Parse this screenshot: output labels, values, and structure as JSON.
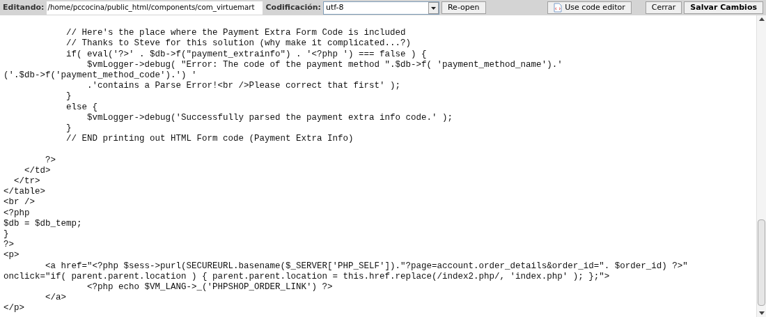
{
  "toolbar": {
    "file_label": "Editando:",
    "file_path": "/home/pccocina/public_html/components/com_virtuemart",
    "encoding_label": "Codificación:",
    "encoding_value": "utf-8",
    "buttons": [
      {
        "label": "Re-open",
        "kind": "plain",
        "bold": false
      },
      {
        "label": "Use code editor",
        "kind": "icon",
        "bold": false
      },
      {
        "label": "Cerrar",
        "kind": "plain",
        "bold": false
      },
      {
        "label": "Salvar Cambios",
        "kind": "plain",
        "bold": true
      }
    ]
  },
  "code_lines": [
    {
      "text": "            // Here's the place where the Payment Extra Form Code is included",
      "gap_before": true
    },
    {
      "text": "            // Thanks to Steve for this solution (why make it complicated...?)",
      "gap_before": false
    },
    {
      "text": "            if( eval('?>' . $db->f(\"payment_extrainfo\") . '<?php ') === false ) {",
      "gap_before": false
    },
    {
      "text": "                $vmLogger->debug( \"Error: The code of the payment method \".$db->f( 'payment_method_name').'",
      "gap_before": false
    },
    {
      "text": "('.$db->f('payment_method_code').') '",
      "gap_before": false
    },
    {
      "text": "                .'contains a Parse Error!<br />Please correct that first' );",
      "gap_before": false
    },
    {
      "text": "            }",
      "gap_before": false
    },
    {
      "text": "            else {",
      "gap_before": false
    },
    {
      "text": "                $vmLogger->debug('Successfully parsed the payment extra info code.' );",
      "gap_before": false
    },
    {
      "text": "            }",
      "gap_before": false
    },
    {
      "text": "            // END printing out HTML Form code (Payment Extra Info)",
      "gap_before": false
    },
    {
      "text": "        ?>",
      "gap_before": true
    },
    {
      "text": "    </td>",
      "gap_before": false
    },
    {
      "text": "  </tr>",
      "gap_before": false
    },
    {
      "text": "</table>",
      "gap_before": false
    },
    {
      "text": "<br />",
      "gap_before": false
    },
    {
      "text": "<?php",
      "gap_before": false
    },
    {
      "text": "$db = $db_temp;",
      "gap_before": false
    },
    {
      "text": "}",
      "gap_before": false
    },
    {
      "text": "?>",
      "gap_before": false
    },
    {
      "text": "<p>",
      "gap_before": false
    },
    {
      "text": "        <a href=\"<?php $sess->purl(SECUREURL.basename($_SERVER['PHP_SELF']).\"?page=account.order_details&order_id=\". $order_id) ?>\"",
      "gap_before": false
    },
    {
      "text": "onclick=\"if( parent.parent.location ) { parent.parent.location = this.href.replace(/index2.php/, 'index.php' ); };\">",
      "gap_before": false
    },
    {
      "text": "                <?php echo $VM_LANG->_('PHPSHOP_ORDER_LINK') ?>",
      "gap_before": false
    },
    {
      "text": "        </a>",
      "gap_before": false
    },
    {
      "text": "</p>",
      "gap_before": false
    }
  ]
}
